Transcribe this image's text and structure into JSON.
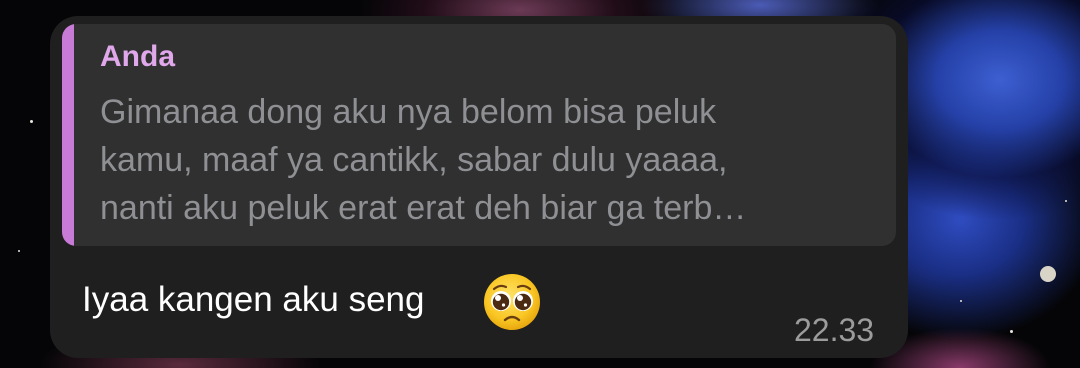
{
  "background": {
    "accent_blue": "#2f4cc0",
    "base": "#050507"
  },
  "message_bubble": {
    "bg_color": "#1f1f1f",
    "quoted_reply": {
      "author": "Anda",
      "author_color": "#e0a8ea",
      "bar_color": "#c77ad6",
      "lines": [
        "Gimanaa dong aku nya belom bisa peluk",
        "kamu, maaf ya cantikk, sabar dulu yaaaa,",
        "nanti aku peluk erat erat deh biar ga terb…"
      ]
    },
    "text": "Iyaa kangen aku seng",
    "emoji": "pleading-face",
    "timestamp": "22.33"
  }
}
